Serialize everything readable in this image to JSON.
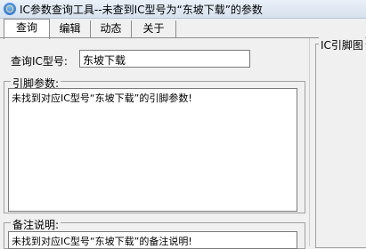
{
  "window": {
    "title": "IC参数查询工具--未查到IC型号为“东坡下载”的参数"
  },
  "tabs": [
    {
      "label": "查询",
      "active": true
    },
    {
      "label": "编辑"
    },
    {
      "label": "动态"
    },
    {
      "label": "关于"
    }
  ],
  "query": {
    "label": "查询IC型号:",
    "value": "东坡下载"
  },
  "pins": {
    "label": "引脚参数:",
    "text": "未找到对应IC型号“东坡下载”的引脚参数!"
  },
  "notes": {
    "label": "备注说明:",
    "text": "未找到对应IC型号“东坡下载”的备注说明!"
  },
  "pin_diagram": {
    "label": "IC引脚图"
  }
}
